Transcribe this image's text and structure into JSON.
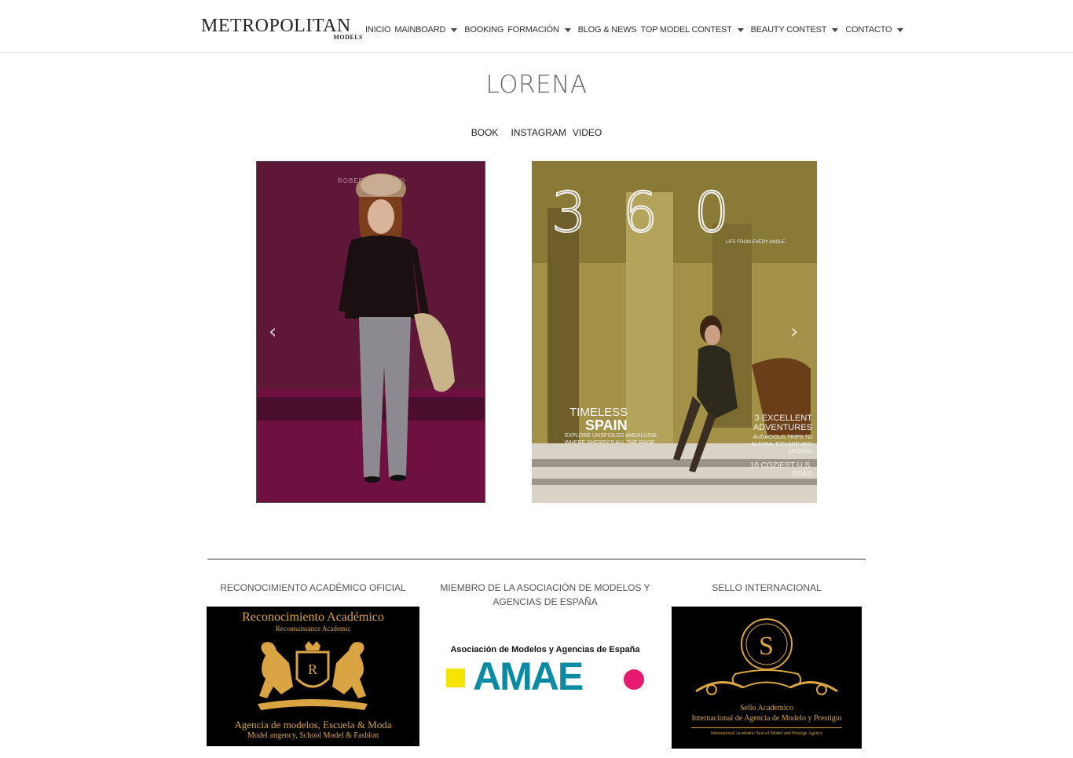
{
  "header": {
    "logo_main": "METROPOLITAN",
    "logo_sub": "MODELS",
    "nav": [
      {
        "label": "INICIO",
        "has_dropdown": false
      },
      {
        "label": "MAINBOARD",
        "has_dropdown": true
      },
      {
        "label": "BOOKING",
        "has_dropdown": false
      },
      {
        "label": "FORMACIÓN",
        "has_dropdown": true
      },
      {
        "label": "BLOG & NEWS",
        "has_dropdown": false
      },
      {
        "label": "TOP MODEL CONTEST",
        "has_dropdown": true
      },
      {
        "label": "BEAUTY CONTEST",
        "has_dropdown": true
      },
      {
        "label": "CONTACTO",
        "has_dropdown": true
      }
    ]
  },
  "page": {
    "title": "LORENA",
    "subnav": [
      "BOOK",
      "INSTAGRAM",
      "VIDEO"
    ]
  },
  "gallery": {
    "cover": {
      "masthead": "3 6 0",
      "tagline": "LIFE FROM EVERY ANGLE",
      "headline1": "TIMELESS",
      "headline2": "SPAIN",
      "dek": "EXPLORE UNSPOILED ANDALUSIA, WHERE SHERRY'S ALL THE RAGE",
      "side1": "3 EXCELLENT ADVENTURES",
      "side2": "AUDACIOUS TRIPS TO ALASKA, ICELAND AND ARIZONA",
      "side3": "10 COZIEST U.S. SPAS"
    },
    "runway_brand": "ROBERTO VERINO",
    "prev_arrow": "‹",
    "next_arrow": "›"
  },
  "footer": {
    "heading1": "RECONOCIMIENTO ACADÉMICO OFICIAL",
    "heading2": "MIEMBRO DE LA ASOCIACIÓN DE MODELOS Y AGENCIAS DE ESPAÑA",
    "heading3": "SELLO INTERNACIONAL",
    "badge1": {
      "title": "Reconocimiento Académico",
      "subtitle": "Reconnaissance Academic",
      "crest_letter": "R",
      "line1": "Agencia de modelos, Escuela & Moda",
      "line2": "Model angency, School Model & Fashion"
    },
    "badge2": {
      "top": "Asociación de Modelos y Agencias de España",
      "word": "AMAE"
    },
    "badge3": {
      "seal_letter": "S",
      "line1": "Sello Academico",
      "line2": "Internacional de Agencia de Modelo y Prestigio",
      "line3": "International Academic Seal of Model and Prestige Agency"
    }
  },
  "colors": {
    "gold": "#d9a441",
    "amae_teal": "#0a8aa3",
    "amae_yellow": "#f5e400",
    "amae_pink": "#e5196e"
  }
}
